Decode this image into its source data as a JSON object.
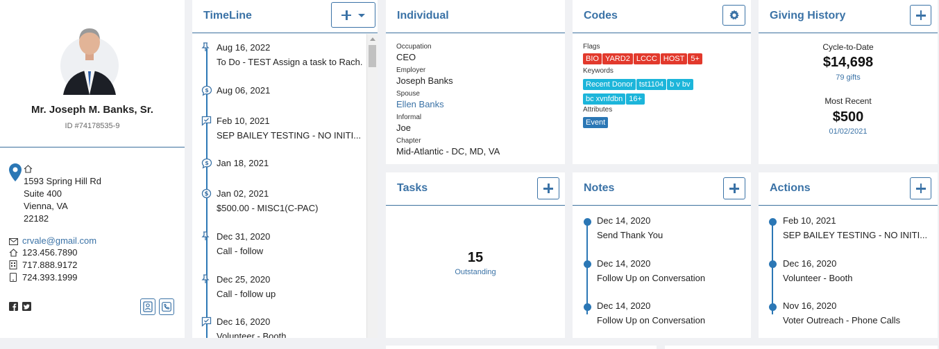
{
  "profile": {
    "name": "Mr. Joseph M. Banks, Sr.",
    "id": "ID #74178535-9",
    "address": [
      "1593 Spring Hill Rd",
      "Suite 400",
      "Vienna, VA",
      "22182"
    ],
    "email": "crvale@gmail.com",
    "phones": [
      "123.456.7890",
      "717.888.9172",
      "724.393.1999"
    ]
  },
  "timeline": {
    "title": "TimeLine",
    "items": [
      {
        "date": "Aug 16, 2022",
        "desc": "To Do - TEST Assign a task to Rach...",
        "icon": "pin-icon"
      },
      {
        "date": "Aug 06, 2021",
        "desc": "",
        "icon": "dollar-chat-icon"
      },
      {
        "date": "Feb 10, 2021",
        "desc": "SEP BAILEY TESTING - NO INITI...",
        "icon": "chat-check-icon"
      },
      {
        "date": "Jan 18, 2021",
        "desc": "",
        "icon": "dollar-chat-icon"
      },
      {
        "date": "Jan 02, 2021",
        "desc": "$500.00 - MISC1(C-PAC)",
        "icon": "dollar-circle-icon"
      },
      {
        "date": "Dec 31, 2020",
        "desc": "Call - follow",
        "icon": "pin-icon"
      },
      {
        "date": "Dec 25, 2020",
        "desc": "Call - follow up",
        "icon": "pin-icon"
      },
      {
        "date": "Dec 16, 2020",
        "desc": "Volunteer - Booth",
        "icon": "chat-check-icon"
      }
    ]
  },
  "individual": {
    "title": "Individual",
    "fields": [
      {
        "label": "Occupation",
        "value": "CEO"
      },
      {
        "label": "Employer",
        "value": "Joseph Banks"
      },
      {
        "label": "Spouse",
        "value": "Ellen Banks"
      },
      {
        "label": "Informal",
        "value": "Joe"
      },
      {
        "label": "Chapter",
        "value": "Mid-Atlantic - DC, MD, VA"
      }
    ]
  },
  "codes": {
    "title": "Codes",
    "flags_label": "Flags",
    "flags": [
      "BIO",
      "YARD2",
      "LCCC",
      "HOST",
      "5+"
    ],
    "keywords_label": "Keywords",
    "keywords": [
      "Recent Donor",
      "tst1104",
      "b v bv",
      "bc xvnfdbn",
      "16+"
    ],
    "attributes_label": "Attributes",
    "attributes": [
      "Event"
    ]
  },
  "giving": {
    "title": "Giving History",
    "ctd_label": "Cycle-to-Date",
    "ctd_amount": "$14,698",
    "gifts": "79 gifts",
    "recent_label": "Most Recent",
    "recent_amount": "$500",
    "recent_date": "01/02/2021"
  },
  "tasks": {
    "title": "Tasks",
    "count": "15",
    "status": "Outstanding"
  },
  "notes": {
    "title": "Notes",
    "items": [
      {
        "date": "Dec 14, 2020",
        "desc": "Send Thank You"
      },
      {
        "date": "Dec 14, 2020",
        "desc": "Follow Up on Conversation"
      },
      {
        "date": "Dec 14, 2020",
        "desc": "Follow Up on Conversation"
      }
    ]
  },
  "actions": {
    "title": "Actions",
    "items": [
      {
        "date": "Feb 10, 2021",
        "desc": "SEP BAILEY TESTING - NO INITI..."
      },
      {
        "date": "Dec 16, 2020",
        "desc": "Volunteer - Booth"
      },
      {
        "date": "Nov 16, 2020",
        "desc": "Voter Outreach - Phone Calls"
      }
    ]
  },
  "colors": {
    "accent": "#3a72a6",
    "flag": "#e2392c",
    "keyword": "#1cb5da",
    "attribute": "#2b77b5"
  }
}
